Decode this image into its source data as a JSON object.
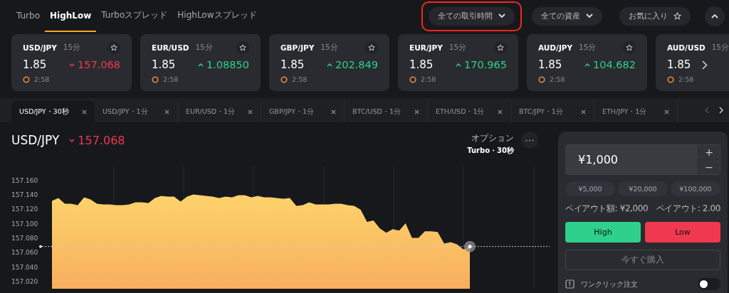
{
  "mode_tabs": [
    {
      "label": "Turbo",
      "selected": false
    },
    {
      "label": "HighLow",
      "selected": true
    },
    {
      "label": "Turboスプレッド",
      "selected": false
    },
    {
      "label": "HighLowスプレッド",
      "selected": false
    }
  ],
  "filters": [
    {
      "kind": "dropdown",
      "label": "全ての取引時間",
      "highlighted": true
    },
    {
      "kind": "dropdown",
      "label": "全ての資産",
      "highlighted": false
    },
    {
      "kind": "favorite",
      "label": "お気に入り",
      "highlighted": false
    }
  ],
  "asset_cards": [
    {
      "pair": "USD/JPY",
      "duration": "15分",
      "payout": "1.85",
      "rising": false,
      "price": "157.068",
      "timer": "2:58"
    },
    {
      "pair": "EUR/USD",
      "duration": "15分",
      "payout": "1.85",
      "rising": true,
      "price": "1.08850",
      "timer": "2:58"
    },
    {
      "pair": "GBP/JPY",
      "duration": "15分",
      "payout": "1.85",
      "rising": true,
      "price": "202.849",
      "timer": "2:58"
    },
    {
      "pair": "EUR/JPY",
      "duration": "15分",
      "payout": "1.85",
      "rising": true,
      "price": "170.965",
      "timer": "2:58"
    },
    {
      "pair": "AUD/JPY",
      "duration": "15分",
      "payout": "1.85",
      "rising": true,
      "price": "104.682",
      "timer": "2:58"
    },
    {
      "pair": "AUD/USD",
      "duration": "15分",
      "payout": "1.85",
      "timer": "2:58"
    }
  ],
  "chart_tabs": [
    {
      "label": "USD/JPY・30秒",
      "selected": true
    },
    {
      "label": "USD/JPY・1分",
      "selected": false
    },
    {
      "label": "EUR/USD・1分",
      "selected": false
    },
    {
      "label": "GBP/JPY・1分",
      "selected": false
    },
    {
      "label": "BTC/USD・1分",
      "selected": false
    },
    {
      "label": "ETH/USD・1分",
      "selected": false
    },
    {
      "label": "BTC/JPY・1分",
      "selected": false
    },
    {
      "label": "ETH/JPY・1分",
      "selected": false
    }
  ],
  "chart_header": {
    "pair": "USD/JPY",
    "rising": false,
    "price": "157.068",
    "option_label": "オプション",
    "option_value": "Turbo・30秒"
  },
  "price_chart": {
    "y_axis_labels": [
      "157.160",
      "157.140",
      "157.120",
      "157.100",
      "157.080",
      "157.060",
      "157.040",
      "157.020"
    ]
  },
  "trade_panel": {
    "amount": "¥1,000",
    "increase": "+",
    "decrease": "−",
    "presets": [
      "¥5,000",
      "¥20,000",
      "¥100,000"
    ],
    "payout_amount": "ペイアウト額: ¥2,000",
    "payout_rate": "ペイアウト: 2.00",
    "high_label": "High",
    "low_label": "Low",
    "buy_label": "今すぐ購入",
    "buy_disabled": true,
    "one_click_label": "ワンクリック注文",
    "one_click_on": false
  }
}
